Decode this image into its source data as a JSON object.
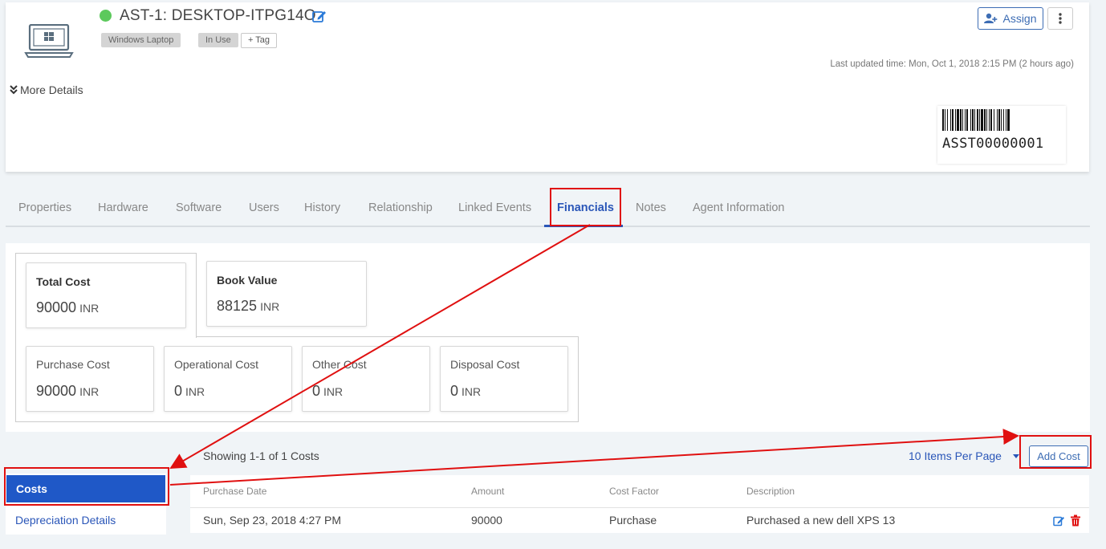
{
  "asset": {
    "title": "AST-1: DESKTOP-ITPG14O",
    "status_color": "#5cc95c",
    "icon": "laptop-icon",
    "tags": [
      "Windows Laptop",
      "In Use"
    ],
    "add_tag_label": "+ Tag",
    "assign_label": "Assign",
    "last_updated": "Last updated time: Mon, Oct 1, 2018 2:15 PM (2 hours ago)",
    "more_details_label": "More Details",
    "barcode_text": "ASST00000001"
  },
  "tabs": [
    {
      "label": "Properties"
    },
    {
      "label": "Hardware"
    },
    {
      "label": "Software"
    },
    {
      "label": "Users"
    },
    {
      "label": "History"
    },
    {
      "label": "Relationship"
    },
    {
      "label": "Linked Events"
    },
    {
      "label": "Financials",
      "active": true
    },
    {
      "label": "Notes"
    },
    {
      "label": "Agent Information"
    }
  ],
  "summary": {
    "total": {
      "label": "Total Cost",
      "value": "90000",
      "unit": "INR"
    },
    "book": {
      "label": "Book Value",
      "value": "88125",
      "unit": "INR"
    },
    "purchase": {
      "label": "Purchase Cost",
      "value": "90000",
      "unit": "INR"
    },
    "operational": {
      "label": "Operational Cost",
      "value": "0",
      "unit": "INR"
    },
    "other": {
      "label": "Other Cost",
      "value": "0",
      "unit": "INR"
    },
    "disposal": {
      "label": "Disposal Cost",
      "value": "0",
      "unit": "INR"
    }
  },
  "list": {
    "showing": "Showing 1-1 of 1 Costs",
    "per_page": "10 Items Per Page",
    "add_cost_label": "Add Cost"
  },
  "side_nav": {
    "active": "Costs",
    "other": "Depreciation Details"
  },
  "table": {
    "headers": [
      "Purchase Date",
      "Amount",
      "Cost Factor",
      "Description"
    ],
    "rows": [
      [
        "Sun, Sep 23, 2018 4:27 PM",
        "90000",
        "Purchase",
        "Purchased a new dell XPS 13"
      ]
    ]
  },
  "colors": {
    "accent": "#2a56b8",
    "active_nav": "#1f58c7",
    "annotation": "#e01010",
    "delete": "#e01010"
  }
}
